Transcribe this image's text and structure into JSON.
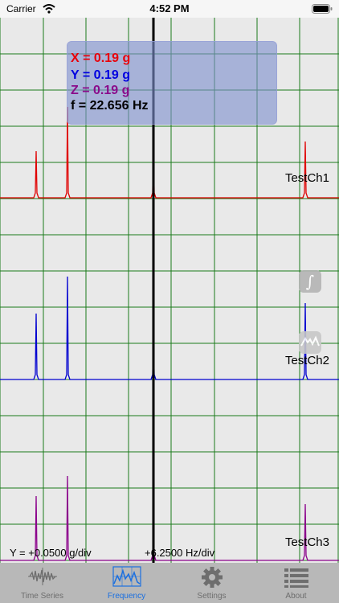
{
  "status_bar": {
    "carrier": "Carrier",
    "time": "4:52 PM"
  },
  "readout": {
    "x": "X = 0.19  g",
    "y": "Y = 0.19  g",
    "z": "Z = 0.19  g",
    "f": "f = 22.656 Hz"
  },
  "channels": [
    {
      "label": "TestCh1",
      "color": "#e00000"
    },
    {
      "label": "TestCh2",
      "color": "#0000d0"
    },
    {
      "label": "TestCh3",
      "color": "#8b008b"
    }
  ],
  "scale": {
    "y": "Y = +0.0500 g/div",
    "x": "+6.2500 Hz/div"
  },
  "grid_color": "#1a7a1a",
  "cursor_color": "#000000",
  "side_buttons": {
    "integrate_icon": "integral-icon",
    "spectrum_icon": "spectrum-icon"
  },
  "tabs": [
    {
      "label": "Time Series",
      "icon": "waveform-icon",
      "selected": false
    },
    {
      "label": "Frequency",
      "icon": "spectrum-icon",
      "selected": true
    },
    {
      "label": "Settings",
      "icon": "gear-icon",
      "selected": false
    },
    {
      "label": "About",
      "icon": "list-icon",
      "selected": false
    }
  ],
  "accent_color": "#1a6fe0"
}
